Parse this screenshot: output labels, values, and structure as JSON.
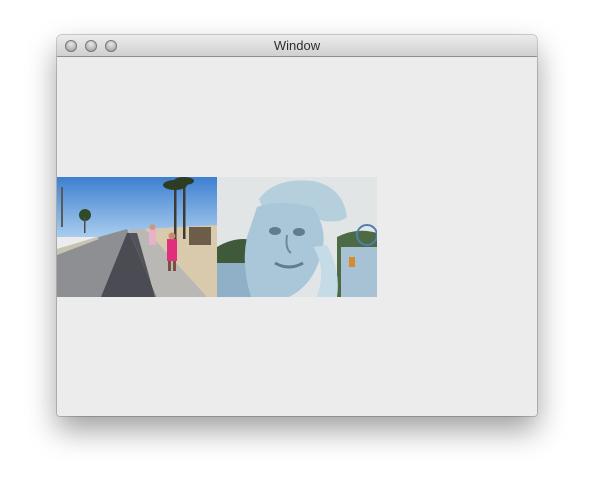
{
  "window": {
    "title": "Window"
  },
  "images": [
    {
      "name": "boardwalk-photo",
      "subject": "beach-promenade"
    },
    {
      "name": "statue-photo",
      "subject": "carved-statue-head"
    }
  ]
}
